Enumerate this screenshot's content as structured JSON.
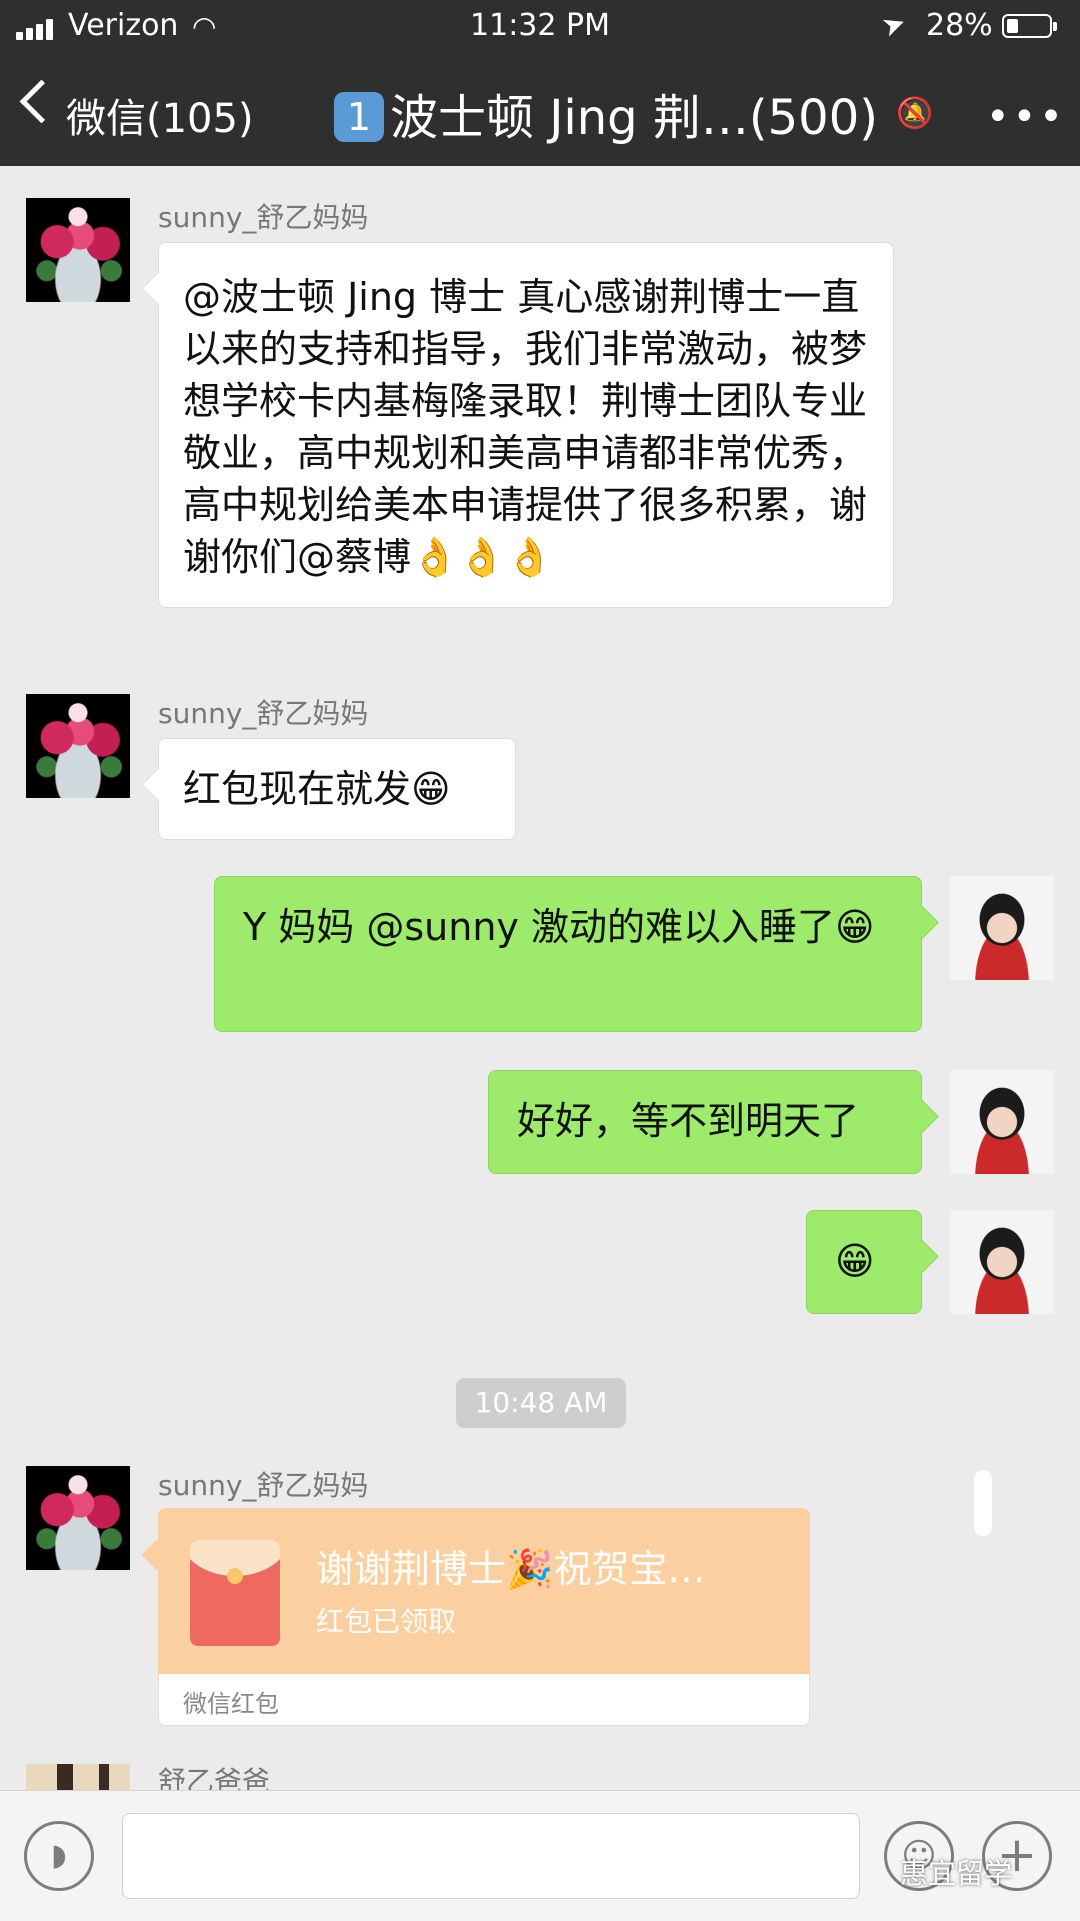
{
  "status_bar": {
    "carrier": "Verizon",
    "time": "11:32 PM",
    "battery_pct": "28%",
    "battery_level": 0.28
  },
  "nav": {
    "back_label": "微信(105)",
    "badge": "1",
    "title": "波士顿 Jing 荆…(500)",
    "more_icon": "more-dots-icon"
  },
  "messages": [
    {
      "sender": "sunny_舒乙妈妈",
      "text": "@波士顿 Jing 博士 真心感谢荆博士一直以来的支持和指导，我们非常激动，被梦想学校卡内基梅隆录取！荆博士团队专业敬业，高中规划和美高申请都非常优秀，高中规划给美本申请提供了很多积累，谢谢你们@蔡博👌👌👌"
    },
    {
      "sender": "sunny_舒乙妈妈",
      "text": "红包现在就发😁"
    },
    {
      "text": "Y 妈妈 @sunny  激动的难以入睡了😁"
    },
    {
      "text": "好好，等不到明天了"
    },
    {
      "text": "😁"
    }
  ],
  "timestamp": "10:48 AM",
  "red_packet": {
    "sender": "sunny_舒乙妈妈",
    "title": "谢谢荆博士🎉祝贺宝…",
    "status": "红包已领取",
    "label": "微信红包"
  },
  "next_sender": "舒乙爸爸",
  "input": {
    "placeholder": ""
  },
  "watermark": "惠宜留学",
  "colors": {
    "header_bg": "#2f2f2f",
    "chat_bg": "#ebebeb",
    "out_bubble": "#9eea6a",
    "packet_bg": "#fbcf9f"
  }
}
